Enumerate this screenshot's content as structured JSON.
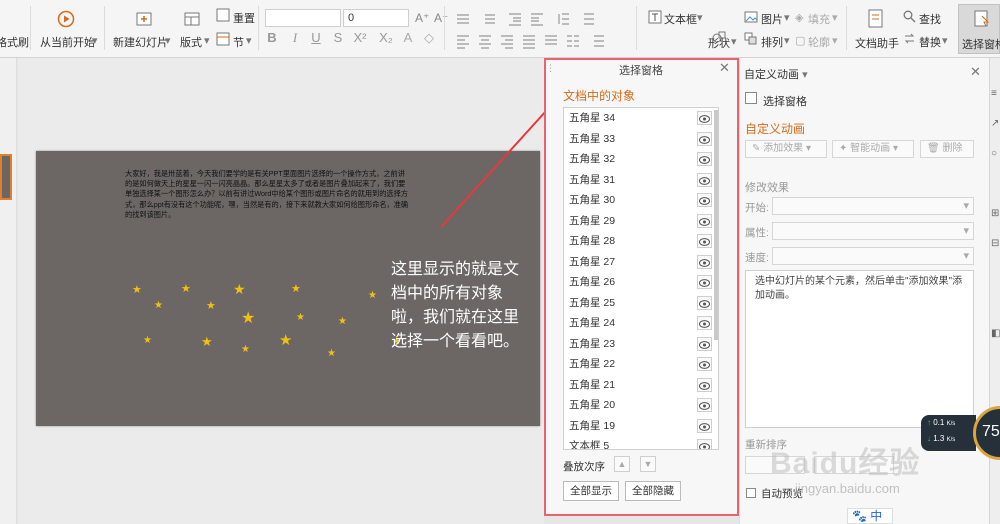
{
  "ribbon": {
    "left_cut": "格式刷",
    "play_from_current": "从当前开始",
    "new_slide": "新建幻灯片",
    "layout": "版式",
    "reset": "重置",
    "section": "节",
    "font_size": "0",
    "textbox": "文本框",
    "picture": "图片",
    "fill": "填充",
    "shape": "形状",
    "arrange": "排列",
    "outline": "轮廓",
    "doc_helper": "文档助手",
    "find": "查找",
    "replace": "替换",
    "selection_pane": "选择窗格"
  },
  "slide": {
    "body_text": "大家好，我是卅蓝着，今天我们要学的是有关PPT里面图片选择的一个操作方式，之前讲的是如何做天上的星星一闪一闪亮晶晶。那么星星太多了或者是图片叠加起来了，我们要单独选择某一个图形怎么办？以前有讲过Word中给某个图形或图片命名的就用到的选择方式，那么ppt有没有这个功能呢，嘿，当然是有的，接下来就教大家如何给图形命名，准确的找到该图片。",
    "callout": "这里显示的就是文档中的所有对象啦，我们就在这里选择一个看看吧。"
  },
  "selection_pane": {
    "title": "选择窗格",
    "subtitle": "文档中的对象",
    "items": [
      {
        "name": "五角星 34"
      },
      {
        "name": "五角星 33"
      },
      {
        "name": "五角星 32"
      },
      {
        "name": "五角星 31"
      },
      {
        "name": "五角星 30"
      },
      {
        "name": "五角星 29"
      },
      {
        "name": "五角星 28"
      },
      {
        "name": "五角星 27"
      },
      {
        "name": "五角星 26"
      },
      {
        "name": "五角星 25"
      },
      {
        "name": "五角星 24"
      },
      {
        "name": "五角星 23"
      },
      {
        "name": "五角星 22"
      },
      {
        "name": "五角星 21"
      },
      {
        "name": "五角星 20"
      },
      {
        "name": "五角星 19"
      },
      {
        "name": "文本框 5"
      }
    ],
    "order_label": "叠放次序",
    "show_all": "全部显示",
    "hide_all": "全部隐藏"
  },
  "anim_pane": {
    "title": "自定义动画",
    "selection_link": "选择窗格",
    "heading": "自定义动画",
    "add_effect": "添加效果",
    "smart_anim": "智能动画",
    "delete": "删除",
    "modify_label": "修改效果",
    "start_label": "开始:",
    "property_label": "属性:",
    "speed_label": "速度:",
    "hint": "选中幻灯片的某个元素，然后单击\"添加效果\"添加动画。",
    "reorder_label": "重新排序",
    "autopreview": "自动预览"
  },
  "net": {
    "up": "0.1",
    "down": "1.3",
    "unit": "K/s",
    "gauge": "75"
  },
  "watermark": {
    "brand": "Baidu经验",
    "url": "jingyan.baidu.com"
  },
  "ime": "中"
}
